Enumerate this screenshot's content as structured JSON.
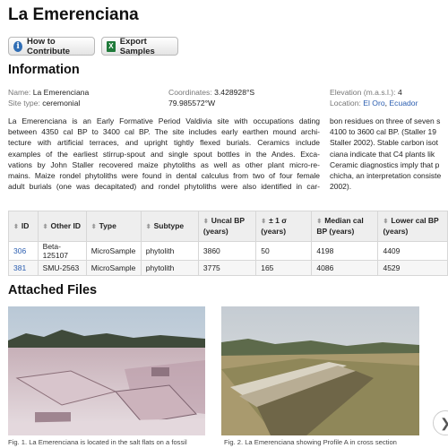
{
  "site": {
    "title": "La Emerenciana"
  },
  "toolbar": {
    "contribute_label": "How to Contribute",
    "export_label": "Export Samples"
  },
  "info": {
    "heading": "Information",
    "name_label": "Name:",
    "name": "La Emerenciana",
    "type_label": "Site type:",
    "type": "ceremonial",
    "coords_label": "Coordinates:",
    "lat": "3.428928°S",
    "lon": "79.985572°W",
    "elev_label": "Elevation (m.a.s.l.):",
    "elev": "4",
    "loc_label": "Location:",
    "loc_region": "El Oro",
    "loc_sep": ", ",
    "loc_country": "Ecuador"
  },
  "description": {
    "col1": [
      "La Emerenciana is an Early Formative Period Valdivia site with occupations dating",
      "between 4350 cal BP to 3400 cal BP. The site includes early earthen mound archi-",
      "tecture with artificial terraces, and upright tightly flexed burials. Ceramics include",
      "examples of the earliest stirrup-spout and single spout bottles in the Andes. Exca-",
      "vations by John Staller recovered maize phytoliths as well as other plant micro-re-",
      "mains. Maize rondel phytoliths were found in dental calculus from two of four female",
      "adult burials (one was decapitated) and rondel phytoliths were also identified in car-"
    ],
    "col2": [
      "bon residues on three of seven s",
      "4100 to 3600 cal BP. (Staller 19",
      "Staller 2002). Stable carbon isot",
      "ciana indicate that C4 plants lik",
      "Ceramic diagnostics imply that p",
      "chicha, an interpretation consiste",
      "2002)."
    ]
  },
  "table": {
    "headers": [
      "ID",
      "Other ID",
      "Type",
      "Subtype",
      "Uncal BP (years)",
      "± 1 σ (years)",
      "Median cal BP (years)",
      "Lower cal BP (years)"
    ],
    "sort_glyph": "⬍",
    "rows": [
      [
        "306",
        "Beta-125107",
        "MicroSample",
        "phytolith",
        "3860",
        "50",
        "4198",
        "4409"
      ],
      [
        "381",
        "SMU-2563",
        "MicroSample",
        "phytolith",
        "3775",
        "165",
        "4086",
        "4529"
      ]
    ]
  },
  "files": {
    "heading": "Attached Files",
    "captions": [
      "Fig. 1. La Emerenciana is located in the salt flats on a fossil",
      "Fig. 2. La Emerenciana showing Profile A in cross section"
    ]
  },
  "icons": {
    "contribute": "info-icon",
    "export": "excel-icon",
    "next": "chevron-right-icon"
  },
  "colors": {
    "link": "#2a5db0",
    "header_bg": "#eeeeee"
  }
}
